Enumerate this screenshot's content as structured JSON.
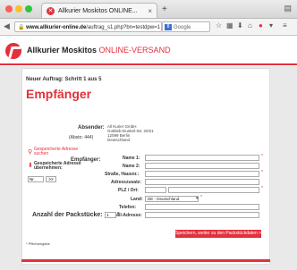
{
  "browser": {
    "tab_title": "Allkurier Moskitos ONLINE...",
    "tab_fav": "✕",
    "tab_close": "×",
    "new_tab": "+",
    "url_host": "www.allkurier-online.de",
    "url_path": "/auftrag_s1.php?bn=testdpw=1",
    "search_engine": "8",
    "search_placeholder": "Google"
  },
  "brand": {
    "name": "Allkurier Moskitos",
    "suffix": "ONLINE-VERSAND",
    "accent": "#e2313c"
  },
  "step_title": "Neuer Auftrag: Schritt 1 aus 5",
  "heading": "Empfänger",
  "sender": {
    "label": "Absender:",
    "number_label": "(Absto: 444)",
    "line1": "All Kurier GmbH",
    "line2": "Gottlieb-Dunkel-Str. 20/21",
    "line3": "12099 Berlin",
    "line4": "Deutschland"
  },
  "recipient": {
    "label": "Empfänger:",
    "search_link_1": "Gespeicherte Adresse",
    "search_link_2": "suchen",
    "saved_1": "Gespeicherte Adresse",
    "saved_2": "übernehmen:",
    "nr_placeholder": "Nr.",
    "go_label": ">>",
    "fields": {
      "name1": "Name 1:",
      "name2": "Name 2:",
      "street": "Straße, Hausnr.:",
      "addr_extra": "Adresszusatz:",
      "zip_city": "PLZ / Ort:",
      "country": "Land:",
      "phone": "Telefon:",
      "email": "E-Mail-Adresse:"
    },
    "country_value": "DE - Deutschland"
  },
  "packages": {
    "label": "Anzahl der Packstücke:",
    "value": "1"
  },
  "submit_label": "Speichern, weiter zu den Packstückdaten >>",
  "required_note": "* Pflichtangabe",
  "required_mark": "*"
}
